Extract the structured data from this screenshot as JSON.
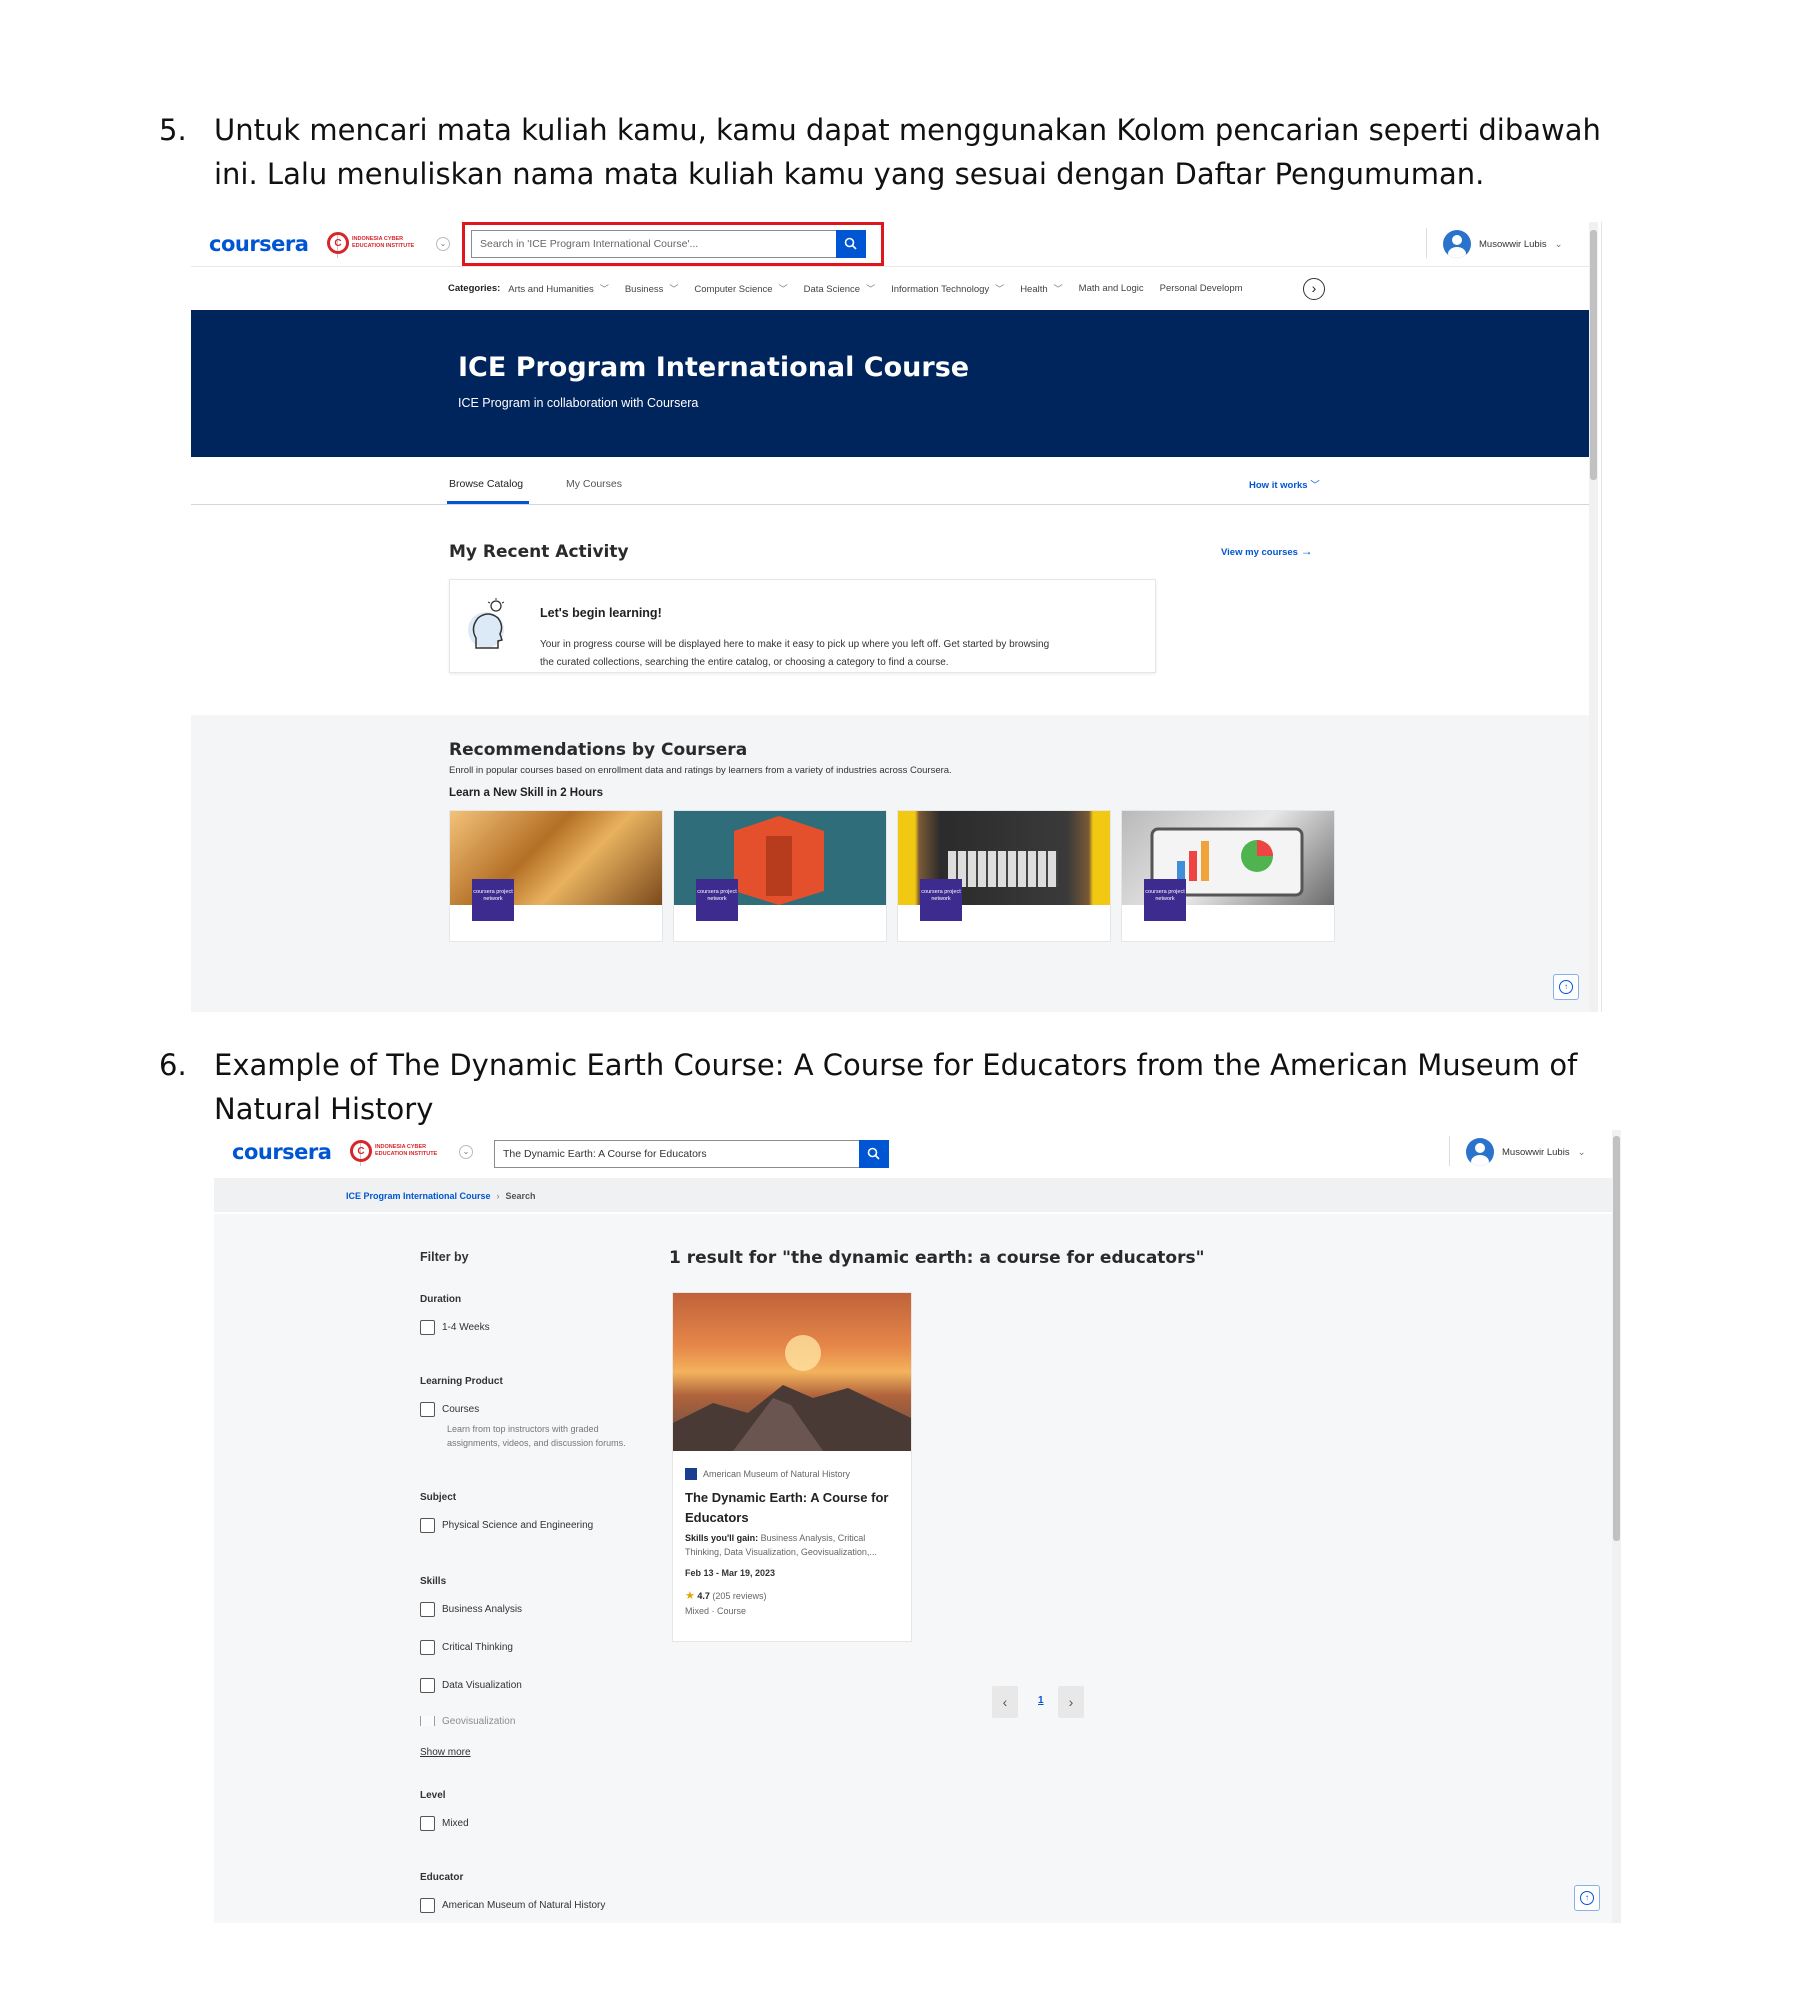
{
  "step5": {
    "number": "5.",
    "text": "Untuk mencari mata kuliah kamu, kamu dapat menggunakan Kolom pencarian seperti dibawah ini. Lalu menuliskan nama mata kuliah kamu yang sesuai dengan Daftar Pengumuman."
  },
  "step6": {
    "number": "6.",
    "text": "Example of The Dynamic Earth Course: A Course for Educators from the American Museum of Natural History"
  },
  "brand": {
    "logo": "coursera",
    "partner_mark": "C",
    "partner_name": "INDONESIA CYBER EDUCATION INSTITUTE",
    "user_name": "Musowwir Lubis",
    "accent": "#0056d2",
    "highlight": "#e0161d"
  },
  "shot1": {
    "search_placeholder": "Search in 'ICE Program International Course'...",
    "categories_label": "Categories:",
    "categories": [
      "Arts and Humanities",
      "Business",
      "Computer Science",
      "Data Science",
      "Information Technology",
      "Health",
      "Math and Logic",
      "Personal Developm"
    ],
    "hero_title": "ICE Program International Course",
    "hero_subtitle": "ICE Program in collaboration with Coursera",
    "tab_browse": "Browse Catalog",
    "tab_courses": "My Courses",
    "how_it_works": "How it works",
    "recent_title": "My Recent Activity",
    "view_courses": "View my courses",
    "begin_title": "Let's begin learning!",
    "begin_desc": "Your in progress course will be displayed here to make it easy to pick up where you left off. Get started by browsing the curated collections, searching the entire catalog, or choosing a category to find a course.",
    "rec_title": "Recommendations by Coursera",
    "rec_sub": "Enroll in popular courses based on enrollment data and ratings by learners from a variety of industries across Coursera.",
    "skill_title": "Learn a New Skill in 2 Hours",
    "badge_text": "coursera project network"
  },
  "shot2": {
    "search_value": "The Dynamic Earth: A Course for Educators",
    "breadcrumb_root": "ICE Program International Course",
    "breadcrumb_current": "Search",
    "filter_title": "Filter by",
    "duration_label": "Duration",
    "duration_opt": "1-4 Weeks",
    "product_label": "Learning Product",
    "product_opt": "Courses",
    "product_help": "Learn from top instructors with graded assignments, videos, and discussion forums.",
    "subject_label": "Subject",
    "subject_opt": "Physical Science and Engineering",
    "skills_label": "Skills",
    "skills_opts": [
      "Business Analysis",
      "Critical Thinking",
      "Data Visualization",
      "Geovisualization"
    ],
    "show_more": "Show more",
    "level_label": "Level",
    "level_opt": "Mixed",
    "educator_label": "Educator",
    "educator_opt": "American Museum of Natural History",
    "result_heading": "1 result for \"the dynamic earth: a course for educators\"",
    "card_partner": "American Museum of Natural History",
    "card_title": "The Dynamic Earth: A Course for Educators",
    "card_skills_label": "Skills you'll gain:",
    "card_skills": "Business Analysis, Critical Thinking, Data Visualization, Geovisualization,...",
    "card_dates": "Feb 13 - Mar 19, 2023",
    "card_rating": "4.7",
    "card_reviews": "(205 reviews)",
    "card_meta": "Mixed · Course",
    "page_number": "1"
  }
}
